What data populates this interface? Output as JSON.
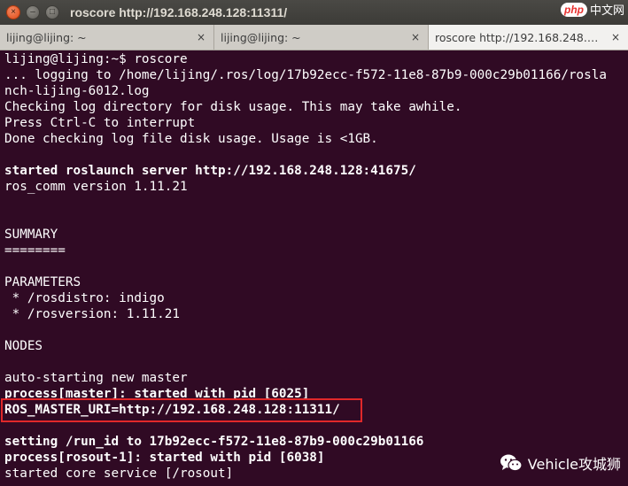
{
  "window": {
    "title": "roscore http://192.168.248.128:11311/",
    "close_glyph": "×",
    "minimize_glyph": "–",
    "maximize_glyph": "□"
  },
  "badge": {
    "logo": "php",
    "text": "中文网"
  },
  "tabs": [
    {
      "label": "lijing@lijing: ~",
      "close": "×"
    },
    {
      "label": "lijing@lijing: ~",
      "close": "×"
    },
    {
      "label": "roscore http://192.168.248.…",
      "close": "×"
    }
  ],
  "terminal": {
    "lines": [
      {
        "text": "lijing@lijing:~$ roscore",
        "bold": false
      },
      {
        "text": "... logging to /home/lijing/.ros/log/17b92ecc-f572-11e8-87b9-000c29b01166/rosla",
        "bold": false
      },
      {
        "text": "nch-lijing-6012.log",
        "bold": false
      },
      {
        "text": "Checking log directory for disk usage. This may take awhile.",
        "bold": false
      },
      {
        "text": "Press Ctrl-C to interrupt",
        "bold": false
      },
      {
        "text": "Done checking log file disk usage. Usage is <1GB.",
        "bold": false
      },
      {
        "text": "",
        "bold": false
      },
      {
        "text": "started roslaunch server http://192.168.248.128:41675/",
        "bold": true
      },
      {
        "text": "ros_comm version 1.11.21",
        "bold": false
      },
      {
        "text": "",
        "bold": false
      },
      {
        "text": "",
        "bold": false
      },
      {
        "text": "SUMMARY",
        "bold": false
      },
      {
        "text": "========",
        "bold": false
      },
      {
        "text": "",
        "bold": false
      },
      {
        "text": "PARAMETERS",
        "bold": false
      },
      {
        "text": " * /rosdistro: indigo",
        "bold": false
      },
      {
        "text": " * /rosversion: 1.11.21",
        "bold": false
      },
      {
        "text": "",
        "bold": false
      },
      {
        "text": "NODES",
        "bold": false
      },
      {
        "text": "",
        "bold": false
      },
      {
        "text": "auto-starting new master",
        "bold": false
      },
      {
        "text": "process[master]: started with pid [6025]",
        "bold": true
      },
      {
        "text": "ROS_MASTER_URI=http://192.168.248.128:11311/",
        "bold": true
      },
      {
        "text": "",
        "bold": false
      },
      {
        "text": "setting /run_id to 17b92ecc-f572-11e8-87b9-000c29b01166",
        "bold": true
      },
      {
        "text": "process[rosout-1]: started with pid [6038]",
        "bold": true
      },
      {
        "text": "started core service [/rosout]",
        "bold": false
      }
    ]
  },
  "watermark": {
    "icon": "wechat-icon",
    "text": "Vehicle攻城狮"
  },
  "colors": {
    "terminal_bg": "#300a24",
    "terminal_fg": "#ffffff",
    "highlight_box": "#e0282a",
    "titlebar_bg": "#3c3b37",
    "tab_active_bg": "#f2f1ef"
  }
}
